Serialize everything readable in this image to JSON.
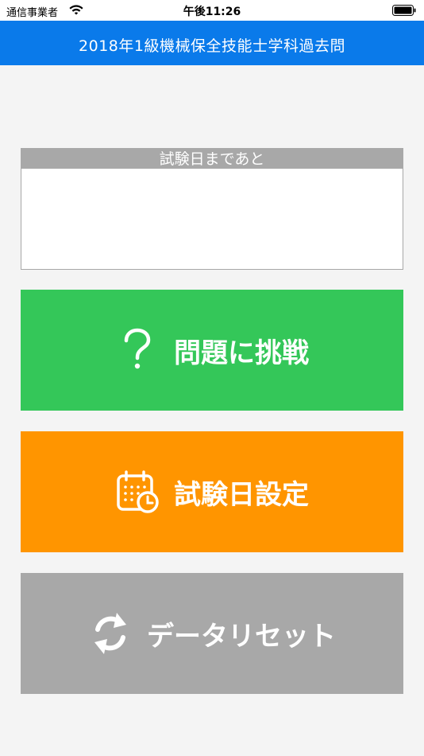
{
  "status_bar": {
    "carrier": "通信事業者",
    "time": "午後11:26"
  },
  "nav": {
    "title": "2018年1級機械保全技能士学科過去問"
  },
  "countdown": {
    "header": "試験日まであと",
    "value": ""
  },
  "actions": {
    "challenge": {
      "label": "問題に挑戦",
      "icon": "question-icon",
      "color": "#34c759"
    },
    "exam_date": {
      "label": "試験日設定",
      "icon": "calendar-clock-icon",
      "color": "#ff9500"
    },
    "reset": {
      "label": "データリセット",
      "icon": "refresh-icon",
      "color": "#a8a8a8"
    }
  },
  "colors": {
    "nav_bar": "#0a7aea",
    "background": "#f4f4f4",
    "countdown_header": "#a8a8a8"
  }
}
